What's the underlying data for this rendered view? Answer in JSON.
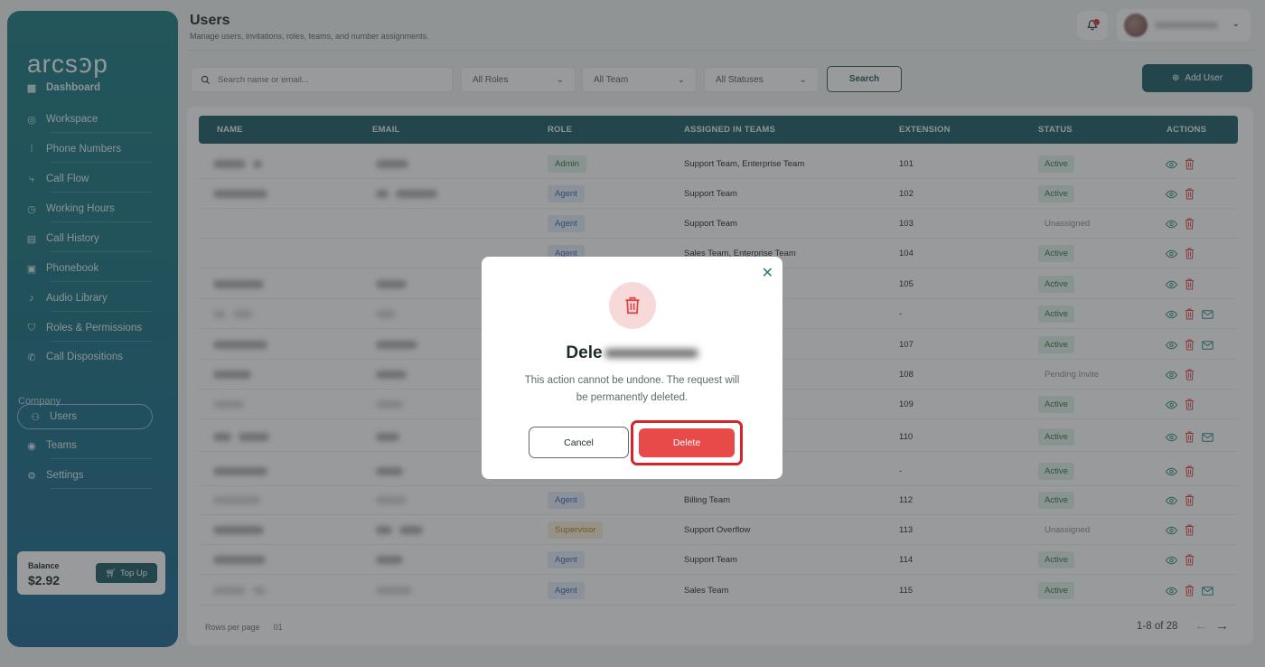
{
  "sidebar": {
    "logo": "arcsꜿp",
    "items": [
      {
        "label": "Dashboard",
        "icon": "grid-icon"
      },
      {
        "label": "Workspace",
        "icon": "workspace-icon"
      },
      {
        "label": "Phone Numbers",
        "icon": "dialpad-icon"
      },
      {
        "label": "Call Flow",
        "icon": "flow-icon"
      },
      {
        "label": "Working Hours",
        "icon": "clock-icon"
      },
      {
        "label": "Call History",
        "icon": "history-icon"
      },
      {
        "label": "Phonebook",
        "icon": "phonebook-icon"
      },
      {
        "label": "Audio Library",
        "icon": "mic-icon"
      },
      {
        "label": "Roles & Permissions",
        "icon": "shield-icon"
      },
      {
        "label": "Call Dispositions",
        "icon": "phone-icon"
      }
    ],
    "company_label": "Company",
    "company_items": [
      {
        "label": "Users",
        "icon": "users-icon"
      },
      {
        "label": "Teams",
        "icon": "teams-icon"
      },
      {
        "label": "Settings",
        "icon": "gear-icon"
      }
    ],
    "balance": {
      "label": "Balance",
      "value": "$2.92",
      "topup_label": "Top Up"
    }
  },
  "header": {
    "title": "Users",
    "subtitle": "Manage users, invitations, roles, teams, and number assignments."
  },
  "filters": {
    "search_placeholder": "Search name or email...",
    "roles": "All Roles",
    "team": "All Team",
    "statuses": "All Statuses",
    "search_button": "Search",
    "add_user_button": "Add User"
  },
  "table": {
    "columns": [
      "NAME",
      "EMAIL",
      "ROLE",
      "ASSIGNED IN TEAMS",
      "EXTENSION",
      "STATUS",
      "ACTIONS"
    ],
    "rows": [
      {
        "role": "Admin",
        "teams": "Support Team, Enterprise Team",
        "ext": "101",
        "status": "Active",
        "mail": false
      },
      {
        "role": "Agent",
        "teams": "Support Team",
        "ext": "102",
        "status": "Active",
        "mail": false
      },
      {
        "role": "Agent",
        "teams": "Support Team",
        "ext": "103",
        "status": "Unassigned",
        "mail": false
      },
      {
        "role": "Agent",
        "teams": "Sales Team, Enterprise Team",
        "ext": "104",
        "status": "Active",
        "mail": false
      },
      {
        "role": "",
        "teams": "",
        "ext": "105",
        "status": "Active",
        "mail": false
      },
      {
        "role": "",
        "teams": "",
        "ext": "-",
        "status": "Active",
        "mail": true
      },
      {
        "role": "",
        "teams": "",
        "ext": "107",
        "status": "Active",
        "mail": true
      },
      {
        "role": "",
        "teams": "",
        "ext": "108",
        "status": "Pending Invite",
        "mail": false
      },
      {
        "role": "",
        "teams": "",
        "ext": "109",
        "status": "Active",
        "mail": false
      },
      {
        "role": "",
        "teams": "",
        "ext": "110",
        "status": "Active",
        "mail": true
      },
      {
        "role": "",
        "teams": "",
        "ext": "-",
        "status": "Active",
        "mail": false
      },
      {
        "role": "Agent",
        "teams": "Billing Team",
        "ext": "112",
        "status": "Active",
        "mail": false
      },
      {
        "role": "Supervisor",
        "teams": "Support Overflow",
        "ext": "113",
        "status": "Unassigned",
        "mail": false
      },
      {
        "role": "Agent",
        "teams": "Support Team",
        "ext": "114",
        "status": "Active",
        "mail": false
      },
      {
        "role": "Agent",
        "teams": "Sales Team",
        "ext": "115",
        "status": "Active",
        "mail": true
      }
    ],
    "rows_per_page_label": "Rows per page",
    "rows_per_page_value": "01",
    "page_range": "1-8 of 28"
  },
  "modal": {
    "title_prefix": "Dele",
    "message": "This action cannot be undone. The request will be permanently deleted.",
    "cancel_label": "Cancel",
    "delete_label": "Delete"
  },
  "colors": {
    "brand": "#1d5f69",
    "danger": "#e84a4a",
    "highlight": "#d5242a"
  }
}
